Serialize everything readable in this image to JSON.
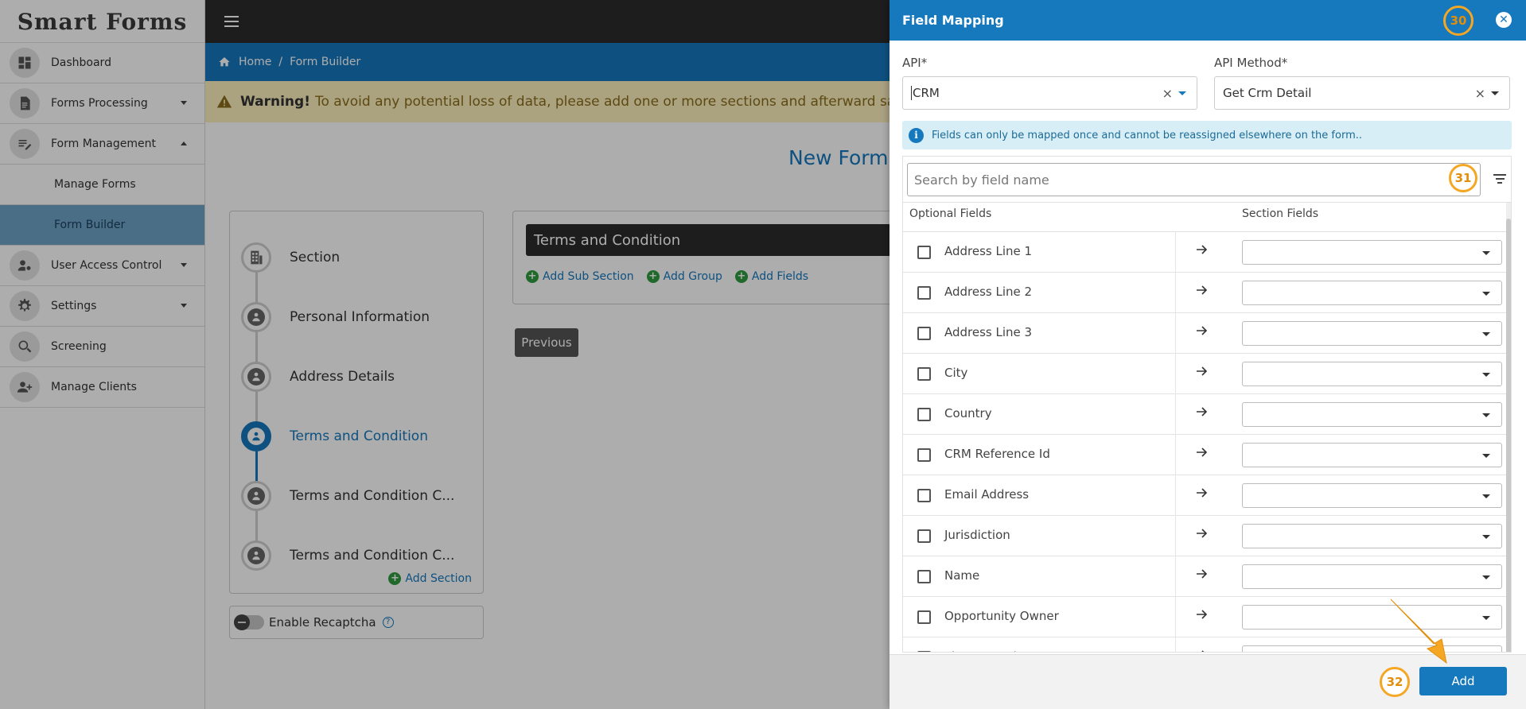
{
  "sidebar": {
    "logo": "Smart Forms",
    "items": [
      {
        "label": "Dashboard",
        "icon": "dashboard-icon"
      },
      {
        "label": "Forms Processing",
        "icon": "document-icon",
        "caret": "down"
      },
      {
        "label": "Form Management",
        "icon": "edit-list-icon",
        "caret": "up"
      },
      {
        "label": "Manage Forms",
        "sub": true
      },
      {
        "label": "Form Builder",
        "sub": true,
        "active": true
      },
      {
        "label": "User Access Control",
        "icon": "user-gear-icon",
        "caret": "down"
      },
      {
        "label": "Settings",
        "icon": "gear-icon",
        "caret": "down"
      },
      {
        "label": "Screening",
        "icon": "search-icon"
      },
      {
        "label": "Manage Clients",
        "icon": "add-user-icon"
      }
    ]
  },
  "breadcrumb": {
    "home": "Home",
    "current": "Form Builder"
  },
  "warning": {
    "title": "Warning!",
    "text": "To avoid any potential loss of data, please add one or more sections and afterward save the fo"
  },
  "form_title": "New Form",
  "steps": [
    {
      "label": "Section"
    },
    {
      "label": "Personal Information"
    },
    {
      "label": "Address Details"
    },
    {
      "label": "Terms and Condition",
      "active": true
    },
    {
      "label": "Terms and Condition C..."
    },
    {
      "label": "Terms and Condition C..."
    }
  ],
  "add_section_label": "Add Section",
  "recaptcha_label": "Enable Recaptcha",
  "content": {
    "header": "Terms and Condition",
    "actions": [
      "Add Sub Section",
      "Add Group",
      "Add Fields"
    ],
    "previous_label": "Previous"
  },
  "drawer": {
    "title": "Field Mapping",
    "badges": [
      "30",
      "31",
      "32"
    ],
    "api_label": "API*",
    "api_value": "CRM",
    "method_label": "API Method*",
    "method_value": "Get Crm Detail",
    "info_text": "Fields can only be mapped once and cannot be reassigned elsewhere on the form..",
    "search_placeholder": "Search by field name",
    "col_optional": "Optional Fields",
    "col_section": "Section Fields",
    "fields": [
      "Address Line 1",
      "Address Line 2",
      "Address Line 3",
      "City",
      "Country",
      "CRM Reference Id",
      "Email Address",
      "Jurisdiction",
      "Name",
      "Opportunity Owner",
      "Phone Number"
    ],
    "add_label": "Add"
  },
  "colors": {
    "primary": "#1678bd",
    "accent_badge": "#f5a623",
    "warning_bg": "#fcefbd",
    "topbar": "#2b2b2b"
  }
}
